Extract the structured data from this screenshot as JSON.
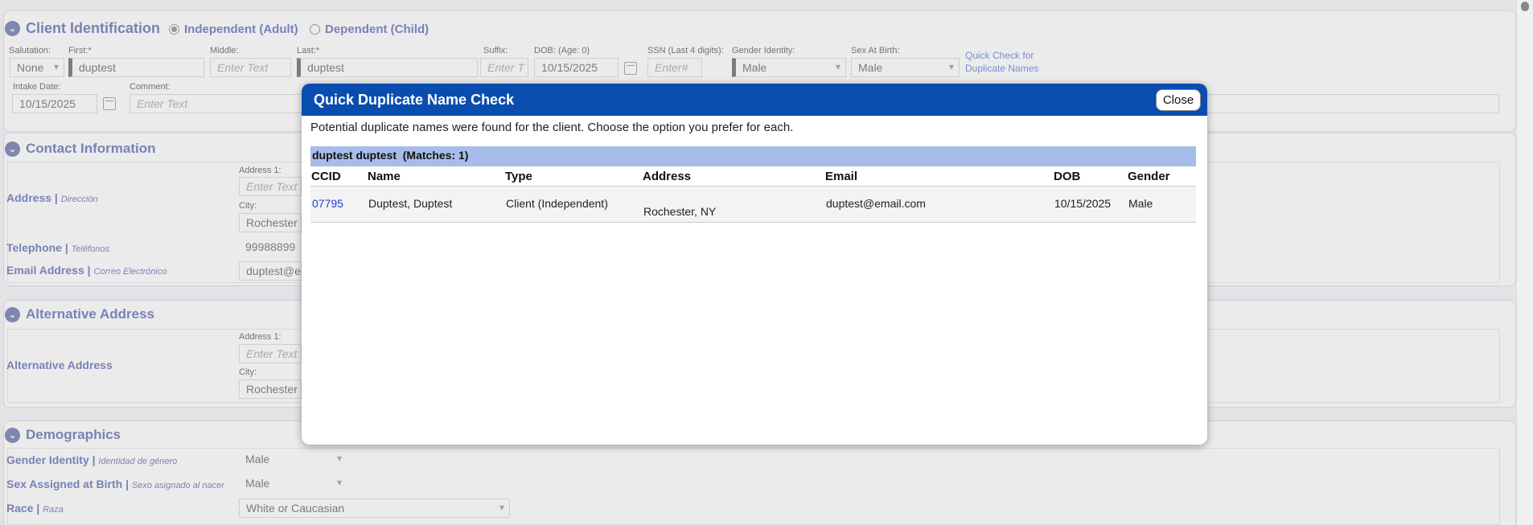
{
  "client_identification": {
    "title": "Client Identification",
    "radio_independent": "Independent (Adult)",
    "radio_dependent": "Dependent (Child)",
    "salutation_label": "Salutation:",
    "salutation_value": "None",
    "first_label": "First:*",
    "first_value": "duptest",
    "middle_label": "Middle:",
    "middle_placeholder": "Enter Text",
    "last_label": "Last:*",
    "last_value": "duptest",
    "suffix_label": "Suffix:",
    "suffix_placeholder": "Enter T",
    "dob_label": "DOB: (Age: 0)",
    "dob_value": "10/15/2025",
    "ssn_label": "SSN (Last 4 digits):",
    "ssn_placeholder": "Enter#",
    "gender_label": "Gender Identity:",
    "gender_value": "Male",
    "sex_label": "Sex At Birth:",
    "sex_value": "Male",
    "quick_check_line1": "Quick Check for",
    "quick_check_line2": "Duplicate Names",
    "intake_label": "Intake Date:",
    "intake_value": "10/15/2025",
    "comment_label": "Comment:",
    "comment_placeholder": "Enter Text"
  },
  "contact_information": {
    "title": "Contact Information",
    "address_label": "Address",
    "address_sub": "Dirección",
    "address1_label": "Address 1:",
    "address1_placeholder": "Enter Text",
    "city_label": "City:",
    "city_value": "Rochester",
    "telephone_label": "Telephone",
    "telephone_sub": "Teléfonos",
    "telephone_value": "99988899",
    "email_label": "Email Address",
    "email_sub": "Correo Electrónico",
    "email_value": "duptest@e"
  },
  "alternative_address": {
    "title": "Alternative Address",
    "row_label": "Alternative Address",
    "address1_label": "Address 1:",
    "address1_placeholder": "Enter Text",
    "city_label": "City:",
    "city_value": "Rochester"
  },
  "demographics": {
    "title": "Demographics",
    "gender_label": "Gender Identity",
    "gender_sub": "Identidad de género",
    "gender_value": "Male",
    "sex_label": "Sex Assigned at Birth",
    "sex_sub": "Sexo asignado al nacer",
    "sex_value": "Male",
    "race_label": "Race",
    "race_sub": "Raza",
    "race_value": "White or Caucasian"
  },
  "modal": {
    "title": "Quick Duplicate Name Check",
    "close_label": "Close",
    "message": "Potential duplicate names were found for the client. Choose the option you prefer for each.",
    "group_header": "duptest duptest  (Matches: 1)",
    "columns": [
      "CCID",
      "Name",
      "Type",
      "Address",
      "Email",
      "DOB",
      "Gender"
    ],
    "rows": [
      {
        "ccid": "07795",
        "name": "Duptest, Duptest",
        "type": "Client (Independent)",
        "address": "Rochester, NY",
        "email": "duptest@email.com",
        "dob": "10/15/2025",
        "gender": "Male"
      }
    ]
  },
  "colors": {
    "modal_header": "#0a4db0",
    "group_header": "#a7bde9",
    "section_title": "#2f3f9a",
    "link": "#2040d0"
  },
  "icons": [
    "chevron-down-icon",
    "calendar-icon",
    "radio-icon",
    "dropdown-arrow-icon"
  ]
}
